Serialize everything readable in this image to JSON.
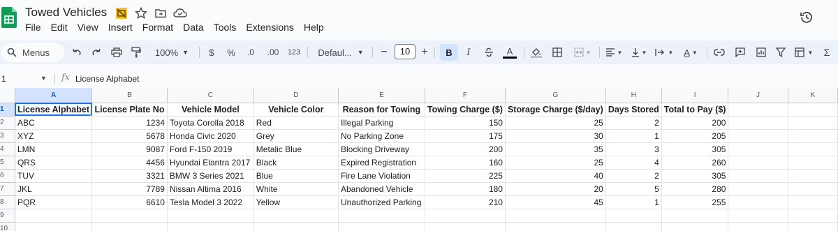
{
  "app": {
    "doc_title": "Towed Vehicles",
    "menu": [
      "File",
      "Edit",
      "View",
      "Insert",
      "Format",
      "Data",
      "Tools",
      "Extensions",
      "Help"
    ]
  },
  "toolbar": {
    "search_label": "Menus",
    "zoom": "100%",
    "currency": "$",
    "percent": "%",
    "dec_decrease": ".0",
    "dec_increase": ".00",
    "number_format": "123",
    "font_name": "Defaul...",
    "font_size": "10",
    "bold": "B",
    "italic": "I",
    "text_color": "A",
    "text_rotation": "A",
    "functions": "Σ"
  },
  "formula_bar": {
    "name_box": "1",
    "fx": "fx",
    "content": "License Alphabet"
  },
  "grid": {
    "columns": [
      "A",
      "B",
      "C",
      "D",
      "E",
      "F",
      "G",
      "H",
      "I",
      "J",
      "K"
    ],
    "row_numbers": [
      "1",
      "2",
      "3",
      "4",
      "5",
      "6",
      "7",
      "8",
      "9",
      "10"
    ],
    "headers": [
      "License Alphabet",
      "License Plate No",
      "Vehicle Model",
      "Vehicle Color",
      "Reason for Towing",
      "Towing Charge ($)",
      "Storage Charge ($/day)",
      "Days Stored",
      "Total to Pay ($)"
    ],
    "rows": [
      [
        "ABC",
        "1234",
        "Toyota Corolla 2018",
        "Red",
        "Illegal Parking",
        "150",
        "25",
        "2",
        "200"
      ],
      [
        "XYZ",
        "5678",
        "Honda Civic 2020",
        "Grey",
        "No Parking Zone",
        "175",
        "30",
        "1",
        "205"
      ],
      [
        "LMN",
        "9087",
        "Ford F-150 2019",
        "Metalic Blue",
        "Blocking Driveway",
        "200",
        "35",
        "3",
        "305"
      ],
      [
        "QRS",
        "4456",
        "Hyundai Elantra 2017",
        "Black",
        "Expired Registration",
        "160",
        "25",
        "4",
        "260"
      ],
      [
        "TUV",
        "3321",
        "BMW 3 Series 2021",
        "Blue",
        "Fire Lane Violation",
        "225",
        "40",
        "2",
        "305"
      ],
      [
        "JKL",
        "7789",
        "Nissan Altima 2016",
        "White",
        "Abandoned Vehicle",
        "180",
        "20",
        "5",
        "280"
      ],
      [
        "PQR",
        "6610",
        "Tesla Model 3 2022",
        "Yellow",
        "Unauthorized Parking",
        "210",
        "45",
        "1",
        "255"
      ]
    ]
  },
  "colors": {
    "sheets_green": "#0f9d58",
    "selection_blue": "#1a73e8",
    "toolbar_bg": "#edf2fa"
  }
}
